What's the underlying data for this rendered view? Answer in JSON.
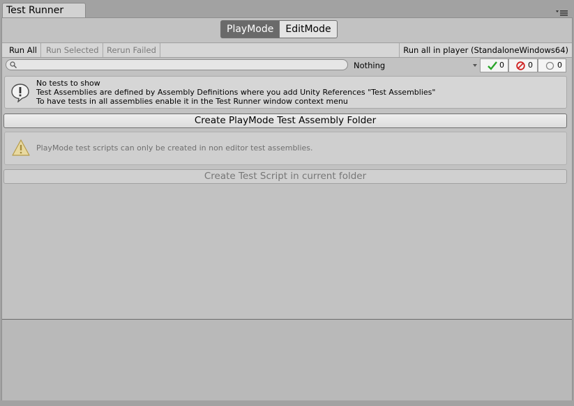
{
  "tab": {
    "title": "Test Runner"
  },
  "mode": {
    "playmode_label": "PlayMode",
    "editmode_label": "EditMode"
  },
  "toolbar": {
    "run_all": "Run All",
    "run_selected": "Run Selected",
    "rerun_failed": "Rerun Failed",
    "run_in_player": "Run all in player (StandaloneWindows64)"
  },
  "filter": {
    "search_placeholder": "",
    "category_selected": "Nothing",
    "passed_count": "0",
    "failed_count": "0",
    "not_run_count": "0"
  },
  "info": {
    "line1": "No tests to show",
    "line2": "Test Assemblies are defined by Assembly Definitions where you add Unity References \"Test Assemblies\"",
    "line3": "To have tests in all assemblies enable it in the Test Runner window context menu"
  },
  "create_folder_button": "Create PlayMode Test Assembly Folder",
  "warning": {
    "text": "PlayMode test scripts can only be created in non editor test assemblies."
  },
  "create_script_button": "Create Test Script in current folder",
  "icons": {
    "search": "search-icon",
    "passed": "checkmark-icon",
    "failed": "forbidden-icon",
    "not_run": "circle-icon",
    "info": "info-icon",
    "warning": "warning-icon",
    "menu": "window-menu-icon"
  },
  "colors": {
    "passed": "#2aa52a",
    "failed": "#d02020",
    "active_mode": "#6a6a6a"
  }
}
